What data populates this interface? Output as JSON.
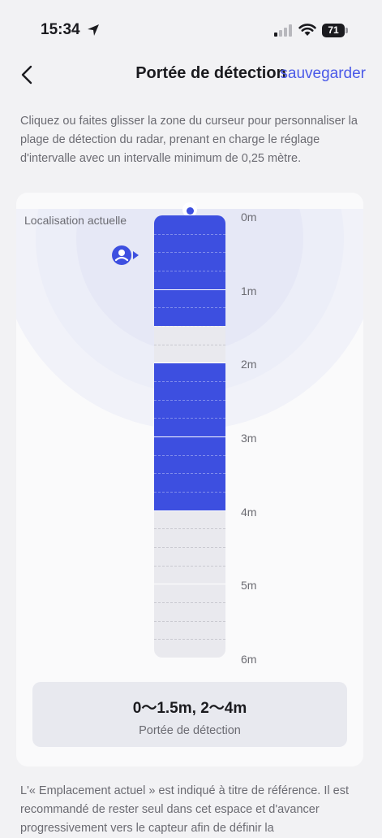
{
  "status_bar": {
    "time": "15:34",
    "battery": "71"
  },
  "nav": {
    "title": "Portée de détection",
    "save_label": "sauvegarder"
  },
  "description": "Cliquez ou faites glisser la zone du curseur pour personnaliser la plage de détection du radar, prenant en charge le réglage d'intervalle avec un intervalle minimum de 0,25 mètre.",
  "radar": {
    "current_location_label": "Localisation actuelle",
    "current_location_m": 0.5,
    "min_m": 0,
    "max_m": 6,
    "step_m": 0.25,
    "selected_ranges_m": [
      [
        0,
        1.5
      ],
      [
        2,
        4
      ]
    ],
    "axis_labels": [
      "0m",
      "1m",
      "2m",
      "3m",
      "4m",
      "5m",
      "6m"
    ],
    "colors": {
      "selected": "#3d4fe0",
      "unselected": "#e9e9ee",
      "ring": "#e4e6f6",
      "accent": "#4b5ae8"
    }
  },
  "result": {
    "value": "0～1.5m, 2～4m",
    "label": "Portée de détection"
  },
  "note": "L'« Emplacement actuel » est indiqué à titre de référence. Il est recommandé de rester seul dans cet espace et d'avancer progressivement vers le capteur afin de définir la"
}
